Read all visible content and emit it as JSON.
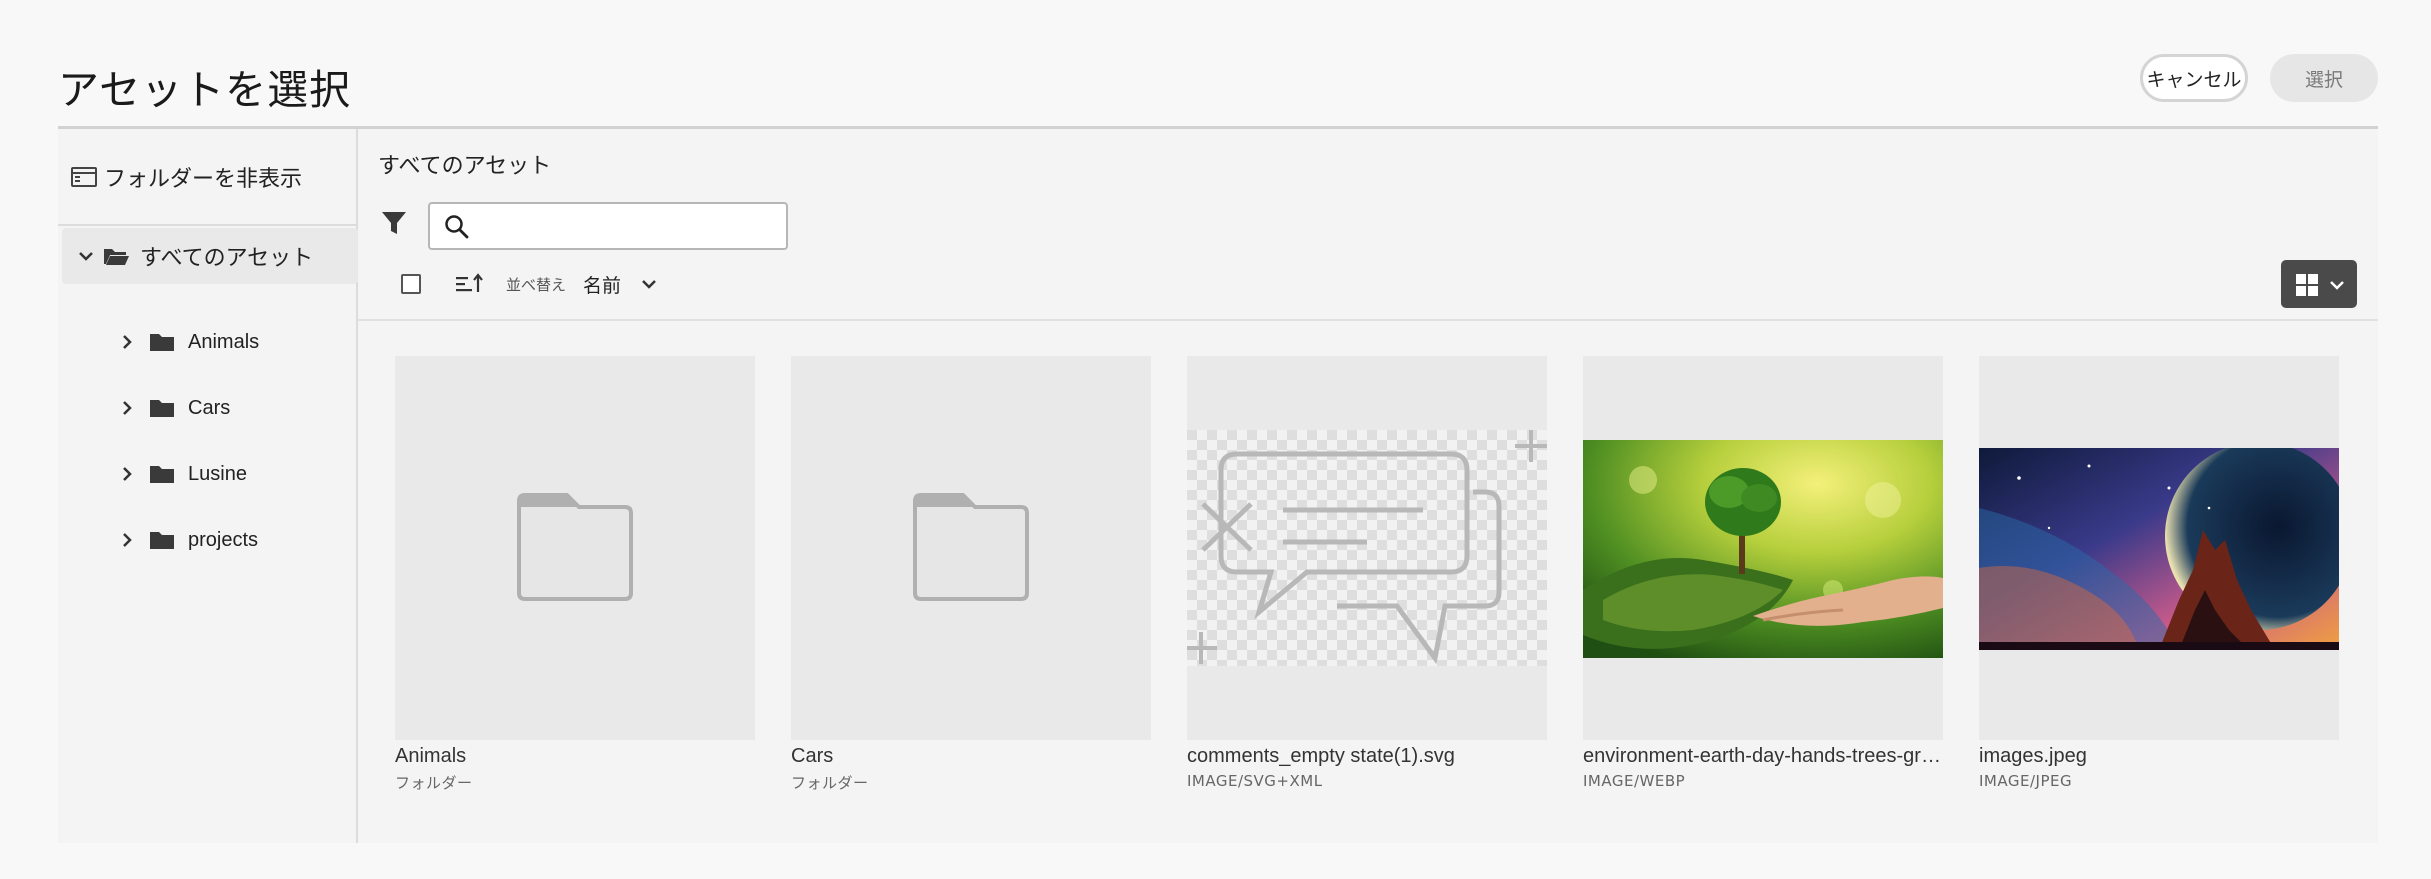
{
  "header": {
    "title": "アセットを選択",
    "cancel_label": "キャンセル",
    "select_label": "選択"
  },
  "sidebar": {
    "hide_folders_label": "フォルダーを非表示",
    "root": {
      "label": "すべてのアセット",
      "icon": "folder-open-icon"
    },
    "items": [
      {
        "label": "Animals",
        "icon": "folder-icon"
      },
      {
        "label": "Cars",
        "icon": "folder-icon"
      },
      {
        "label": "Lusine",
        "icon": "folder-icon"
      },
      {
        "label": "projects",
        "icon": "folder-icon"
      }
    ]
  },
  "main": {
    "title": "すべてのアセット",
    "search": {
      "placeholder": "",
      "value": ""
    },
    "sort": {
      "label": "並べ替え",
      "value": "名前"
    },
    "view_mode": "grid-icon",
    "assets": [
      {
        "name": "Animals",
        "type": "フォルダー",
        "thumbnail": "folder-icon"
      },
      {
        "name": "Cars",
        "type": "フォルダー",
        "thumbnail": "folder-icon"
      },
      {
        "name": "comments_empty state(1).svg",
        "type": "IMAGE/SVG+XML",
        "thumbnail": "comments-empty-state-illustration"
      },
      {
        "name": "environment-earth-day-hands-trees-gro...",
        "type": "IMAGE/WEBP",
        "thumbnail": "tree-in-hand-photo"
      },
      {
        "name": "images.jpeg",
        "type": "IMAGE/JPEG",
        "thumbnail": "cosmic-planet-mountain-photo"
      }
    ]
  },
  "colors": {
    "background": "#f8f8f8",
    "panel": "#f4f4f4",
    "thumb_bg": "#e9e9e9",
    "toggle_bg": "#4a4a4a"
  }
}
